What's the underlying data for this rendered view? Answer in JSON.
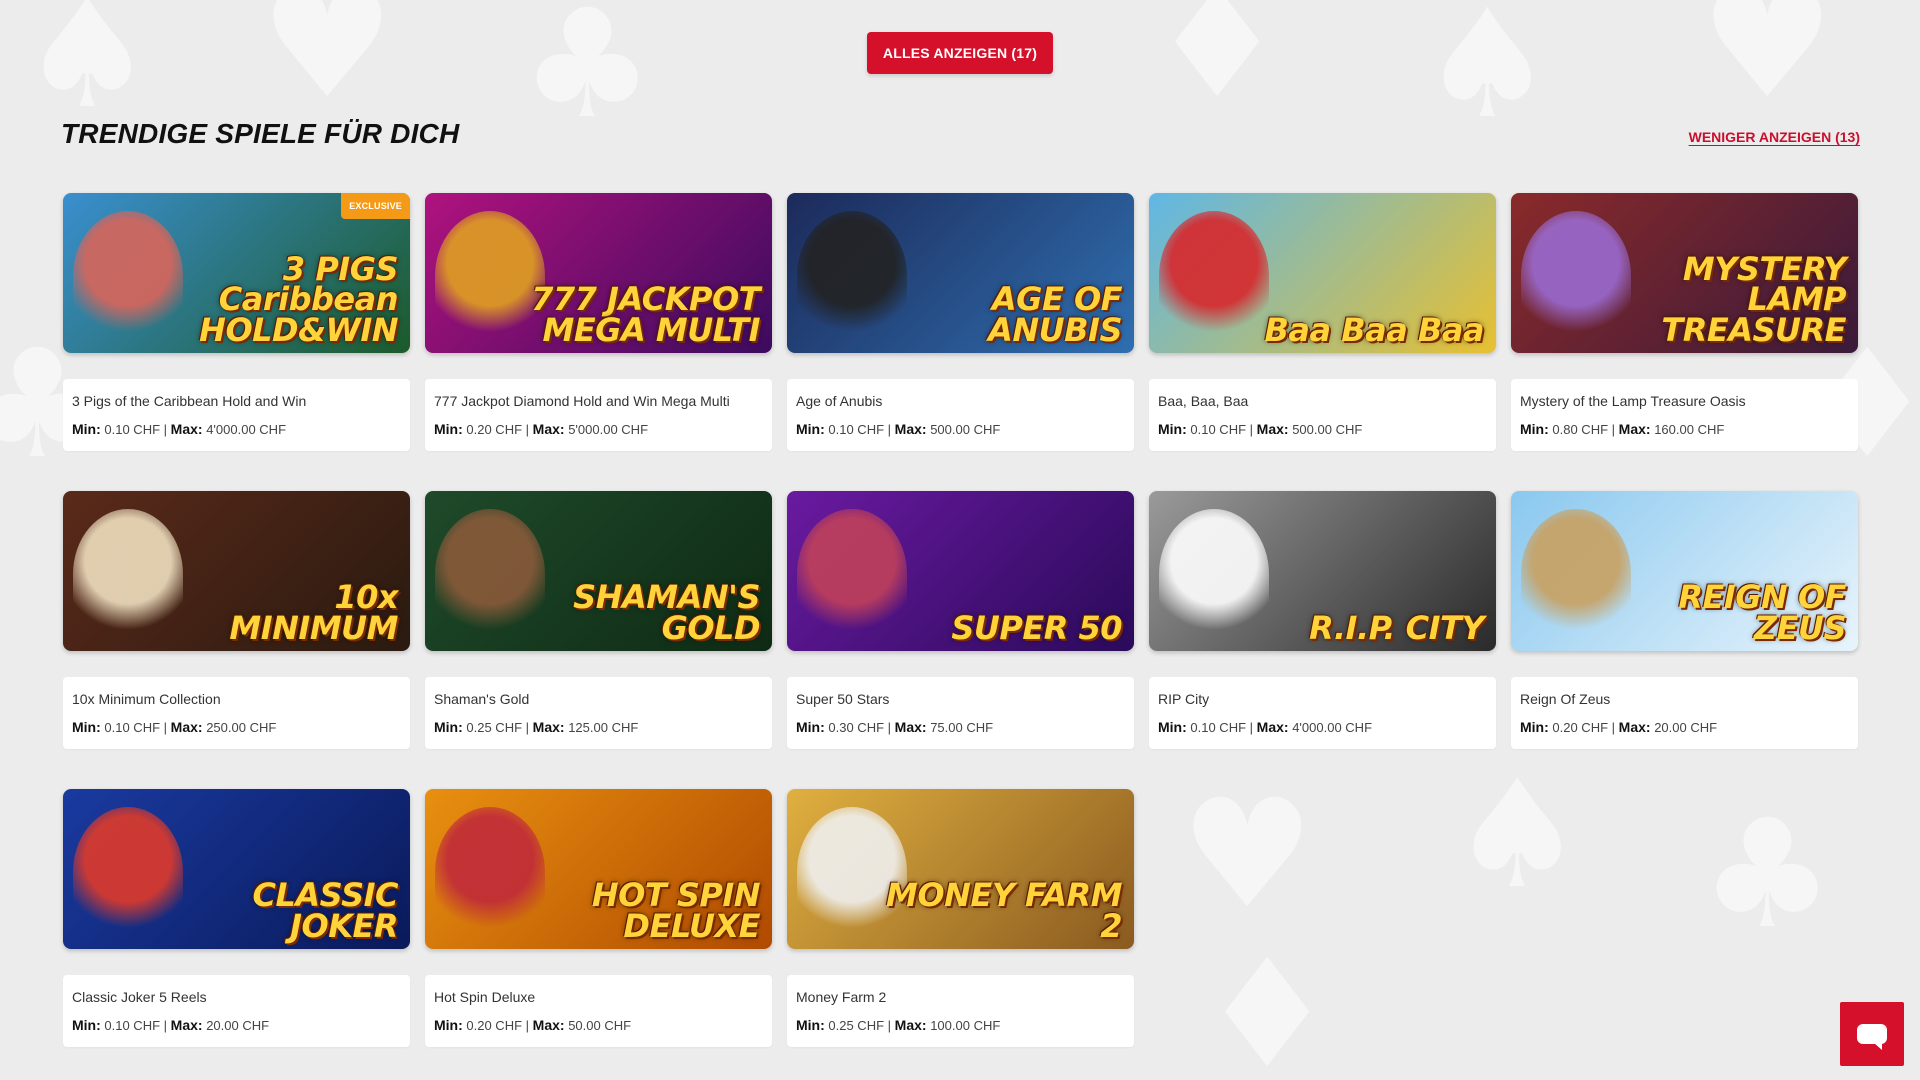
{
  "top_button": {
    "label": "ALLES ANZEIGEN (17)"
  },
  "section": {
    "title": "TRENDIGE SPIELE FÜR DICH",
    "toggle_label": "WENIGER ANZEIGEN (13)"
  },
  "limit_labels": {
    "min": "Min:",
    "max": "Max:",
    "separator": "|"
  },
  "games": [
    {
      "name": "3 Pigs of the Caribbean Hold and Win",
      "min": "0.10 CHF",
      "max": "4'000.00 CHF",
      "art_title": "3 PIGS Caribbean HOLD&WIN",
      "badge": "EXCLUSIVE",
      "colors": [
        "#3a8fcf",
        "#1c5a2a"
      ],
      "art_color": "#d9655a"
    },
    {
      "name": "777 Jackpot Diamond Hold and Win Mega Multi",
      "min": "0.20 CHF",
      "max": "5'000.00 CHF",
      "art_title": "777 JACKPOT MEGA MULTI",
      "badge": "",
      "colors": [
        "#b0127e",
        "#3b0b5e"
      ],
      "art_color": "#e0a020"
    },
    {
      "name": "Age of Anubis",
      "min": "0.10 CHF",
      "max": "500.00 CHF",
      "art_title": "AGE OF ANUBIS",
      "badge": "",
      "colors": [
        "#1c2a5a",
        "#2f6fb0"
      ],
      "art_color": "#222222"
    },
    {
      "name": "Baa, Baa, Baa",
      "min": "0.10 CHF",
      "max": "500.00 CHF",
      "art_title": "Baa Baa Baa",
      "badge": "",
      "colors": [
        "#5fb7e6",
        "#e8c030"
      ],
      "art_color": "#d8262a"
    },
    {
      "name": "Mystery of the Lamp Treasure Oasis",
      "min": "0.80 CHF",
      "max": "160.00 CHF",
      "art_title": "MYSTERY LAMP TREASURE",
      "badge": "",
      "colors": [
        "#8a2a2a",
        "#3a1a3a"
      ],
      "art_color": "#9a6ad0"
    },
    {
      "name": "10x Minimum Collection",
      "min": "0.10 CHF",
      "max": "250.00 CHF",
      "art_title": "10x MINIMUM",
      "badge": "",
      "colors": [
        "#5a2a1a",
        "#2a1a10"
      ],
      "art_color": "#f0e0c0"
    },
    {
      "name": "Shaman's Gold",
      "min": "0.25 CHF",
      "max": "125.00 CHF",
      "art_title": "SHAMAN'S GOLD",
      "badge": "",
      "colors": [
        "#1f4a2a",
        "#0e2a14"
      ],
      "art_color": "#8a5a3a"
    },
    {
      "name": "Super 50 Stars",
      "min": "0.30 CHF",
      "max": "75.00 CHF",
      "art_title": "SUPER 50",
      "badge": "",
      "colors": [
        "#6a1aa0",
        "#2a0a5a"
      ],
      "art_color": "#c0405a"
    },
    {
      "name": "RIP City",
      "min": "0.10 CHF",
      "max": "4'000.00 CHF",
      "art_title": "R.I.P. CITY",
      "badge": "",
      "colors": [
        "#9a9a9a",
        "#2a2a2a"
      ],
      "art_color": "#ffffff"
    },
    {
      "name": "Reign Of Zeus",
      "min": "0.20 CHF",
      "max": "20.00 CHF",
      "art_title": "REIGN OF ZEUS",
      "badge": "",
      "colors": [
        "#8ac8ef",
        "#e8f4fb"
      ],
      "art_color": "#c8a060"
    },
    {
      "name": "Classic Joker 5 Reels",
      "min": "0.10 CHF",
      "max": "20.00 CHF",
      "art_title": "CLASSIC JOKER",
      "badge": "",
      "colors": [
        "#1a3aa0",
        "#0a1a5a"
      ],
      "art_color": "#e03a2a"
    },
    {
      "name": "Hot Spin Deluxe",
      "min": "0.20 CHF",
      "max": "50.00 CHF",
      "art_title": "HOT SPIN DELUXE",
      "badge": "",
      "colors": [
        "#e89010",
        "#b04a00"
      ],
      "art_color": "#c02a3a"
    },
    {
      "name": "Money Farm 2",
      "min": "0.25 CHF",
      "max": "100.00 CHF",
      "art_title": "MONEY FARM 2",
      "badge": "",
      "colors": [
        "#e0b040",
        "#8a5a20"
      ],
      "art_color": "#f0f0f0"
    }
  ],
  "chat": {
    "icon": "chat-icon",
    "color": "#d4102a"
  },
  "accent_color": "#d4102a"
}
